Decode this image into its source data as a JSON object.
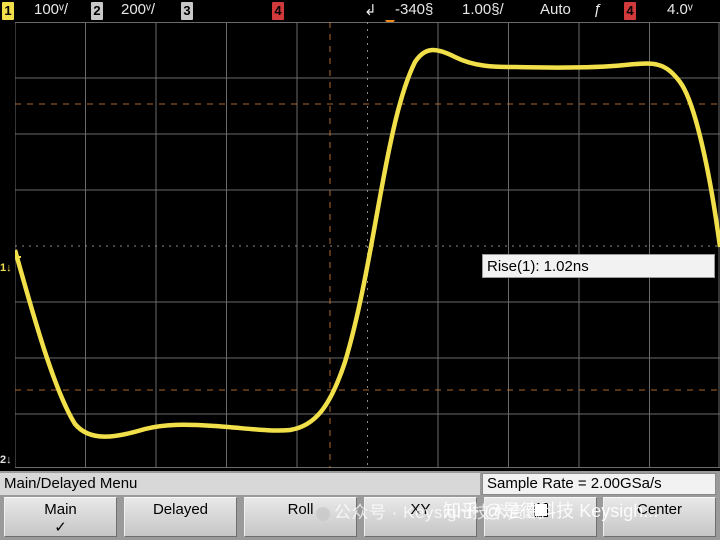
{
  "status_bar": {
    "ch1": {
      "badge": "1",
      "scale": "100ᵛ/"
    },
    "ch2": {
      "badge": "2",
      "scale": "200ᵛ/"
    },
    "ch3": {
      "badge": "3"
    },
    "ch4": {
      "badge": "4"
    },
    "time_delay": "-340§",
    "time_scale": "1.00§/",
    "trigger_mode": "Auto",
    "trigger_slope_icon": "rising-edge-icon",
    "trigger_source_badge": "4",
    "trigger_level": "4.0ᵛ"
  },
  "screen": {
    "ch1_ground_label": "1↓",
    "ch2_ground_label": "2↓",
    "measurement": "Rise(1): 1.02ns",
    "trace_color": "#f2e04a"
  },
  "menu": {
    "title": "Main/Delayed Menu",
    "sample_rate": "Sample Rate = 2.00GSa/s",
    "softkeys": [
      {
        "label": "Main",
        "sub": "✓"
      },
      {
        "label": "Delayed",
        "sub": ""
      },
      {
        "label": "Roll",
        "sub": ""
      },
      {
        "label": "XY",
        "sub": ""
      },
      {
        "label": "",
        "sub": ""
      },
      {
        "label": "",
        "sub": "Center"
      }
    ]
  },
  "watermark": {
    "account": "公众号 · Keysight技术资讯",
    "zhihu": "知乎 @是德科技 Keysigh..."
  }
}
